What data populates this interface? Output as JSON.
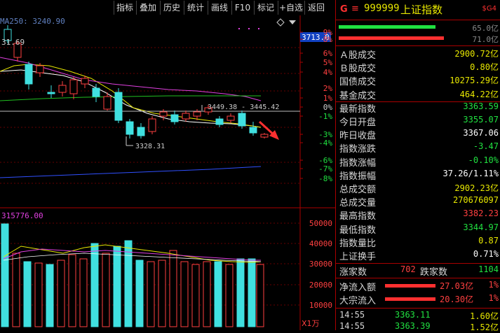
{
  "toolbar": {
    "buttons": [
      "指标",
      "叠加",
      "历史",
      "统计",
      "画线",
      "F10",
      "标记",
      "+自选",
      "返回"
    ]
  },
  "main_chart": {
    "ma_label": "MA250: 3240.90",
    "right_value_tag": "3713.0",
    "top_left_value": "31.69",
    "annotation_high": "3449.38 - 3445.42",
    "annotation_low": "3328.31",
    "pct_ticks": [
      "9%",
      "8%",
      "6%",
      "5%",
      "4%",
      "2%",
      "1%",
      "0%",
      "-1%",
      "-3%",
      "-4%",
      "-6%",
      "-7%",
      "-8%"
    ]
  },
  "volume_chart": {
    "label": "315776.00",
    "ticks": [
      "50000",
      "40000",
      "30000",
      "20000",
      "10000"
    ],
    "unit_label": "X1万"
  },
  "panel": {
    "header": {
      "g_label": "G",
      "menu_icon": "≡",
      "code": "999999",
      "name": "上证指数",
      "badge": "$G4"
    },
    "bars": [
      {
        "value": "65.0亿",
        "color": "#20e040",
        "fraction": 0.6
      },
      {
        "value": "71.0亿",
        "color": "#ff3030",
        "fraction": 0.65
      }
    ],
    "rows": [
      {
        "label": "Ａ股成交",
        "value": "2900.72亿",
        "color": "yellow"
      },
      {
        "label": "Ｂ股成交",
        "value": "0.80亿",
        "color": "yellow"
      },
      {
        "label": "国债成交",
        "value": "10275.29亿",
        "color": "yellow"
      },
      {
        "label": "基金成交",
        "value": "464.22亿",
        "color": "yellow"
      },
      {
        "label": "最新指数",
        "value": "3363.59",
        "color": "green"
      },
      {
        "label": "今日开盘",
        "value": "3355.07",
        "color": "green"
      },
      {
        "label": "昨日收盘",
        "value": "3367.06",
        "color": "white"
      },
      {
        "label": "指数涨跌",
        "value": "-3.47",
        "color": "green"
      },
      {
        "label": "指数涨幅",
        "value": "-0.10%",
        "color": "green"
      },
      {
        "label": "指数振幅",
        "value": "37.26/1.11%",
        "color": "white"
      },
      {
        "label": "总成交额",
        "value": "2902.23亿",
        "color": "yellow"
      },
      {
        "label": "总成交量",
        "value": "270676097",
        "color": "yellow"
      },
      {
        "label": "最高指数",
        "value": "3382.23",
        "color": "red"
      },
      {
        "label": "最低指数",
        "value": "3344.97",
        "color": "green"
      },
      {
        "label": "指数量比",
        "value": "0.87",
        "color": "yellow"
      },
      {
        "label": "上证换手",
        "value": "0.71%",
        "color": "white"
      }
    ],
    "updown": {
      "up_label": "涨家数",
      "up_value": "702",
      "down_label": "跌家数",
      "down_value": "1104"
    },
    "flows": [
      {
        "label": "净流入额",
        "value": "27.03亿",
        "pct": "1%"
      },
      {
        "label": "大宗流入",
        "value": "20.30亿",
        "pct": "1%"
      }
    ],
    "ticks": [
      {
        "time": "14:55",
        "price": "3363.11",
        "vol": "1.60亿"
      },
      {
        "time": "14:55",
        "price": "3363.39",
        "vol": "1.52亿"
      }
    ]
  }
}
